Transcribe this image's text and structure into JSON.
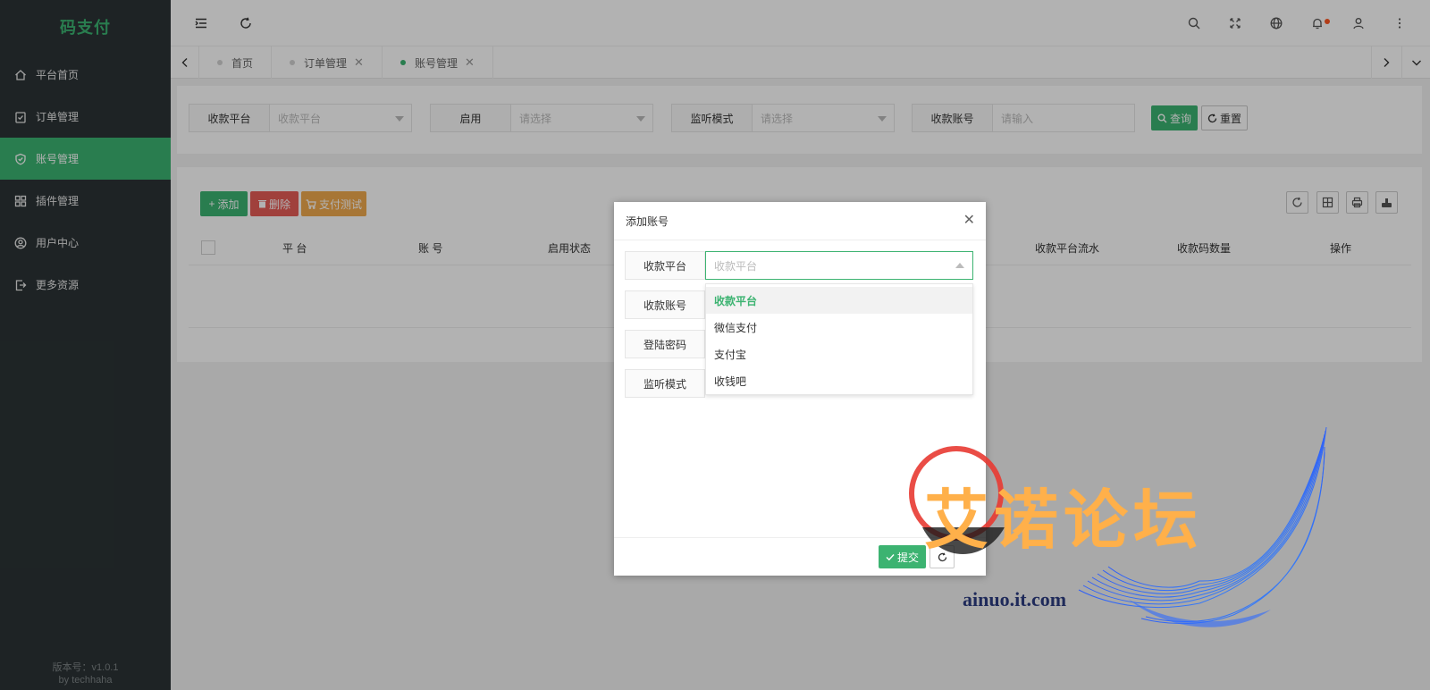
{
  "app": {
    "logo": "码支付",
    "version": "版本号：v1.0.1",
    "author": "by techhaha"
  },
  "sidebar": {
    "items": [
      {
        "label": "平台首页",
        "icon": "home-icon",
        "active": false
      },
      {
        "label": "订单管理",
        "icon": "clipboard-check-icon",
        "active": false
      },
      {
        "label": "账号管理",
        "icon": "shield-check-icon",
        "active": true
      },
      {
        "label": "插件管理",
        "icon": "grid-icon",
        "active": false
      },
      {
        "label": "用户中心",
        "icon": "user-circle-icon",
        "active": false
      },
      {
        "label": "更多资源",
        "icon": "export-icon",
        "active": false
      }
    ]
  },
  "header": {
    "left_icons": [
      "menu-fold-icon",
      "refresh-icon"
    ],
    "right_icons": [
      "search-icon",
      "fullscreen-icon",
      "globe-icon",
      "bell-icon",
      "user-icon",
      "more-vertical-icon"
    ]
  },
  "tabs": [
    {
      "label": "首页",
      "closable": false,
      "active": false
    },
    {
      "label": "订单管理",
      "closable": true,
      "active": false
    },
    {
      "label": "账号管理",
      "closable": true,
      "active": true
    }
  ],
  "search": {
    "fields": [
      {
        "label": "收款平台",
        "placeholder": "收款平台",
        "type": "select"
      },
      {
        "label": "启用",
        "placeholder": "请选择",
        "type": "select"
      },
      {
        "label": "监听模式",
        "placeholder": "请选择",
        "type": "select"
      },
      {
        "label": "收款账号",
        "placeholder": "请输入",
        "type": "input"
      }
    ],
    "query_label": "查询",
    "reset_label": "重置"
  },
  "toolbar": {
    "add_label": "添加",
    "delete_label": "删除",
    "paytest_label": "支付测试"
  },
  "table": {
    "columns": [
      "平 台",
      "账 号",
      "启用状态",
      "收款平台流水",
      "收款码数量",
      "操作"
    ]
  },
  "modal": {
    "title": "添加账号",
    "fields": [
      "收款平台",
      "收款账号",
      "登陆密码",
      "监听模式"
    ],
    "select_placeholder": "收款平台",
    "options": [
      "收款平台",
      "微信支付",
      "支付宝",
      "收钱吧"
    ],
    "selected_index": 0,
    "submit_label": "提交"
  },
  "watermark": {
    "title": "艾诺论坛",
    "url": "ainuo.it.com"
  },
  "colors": {
    "accent": "#3cb371",
    "sidebar_bg": "#2b3335",
    "danger": "#e65c57",
    "warning": "#f0a94e",
    "badge": "#ff5722"
  }
}
